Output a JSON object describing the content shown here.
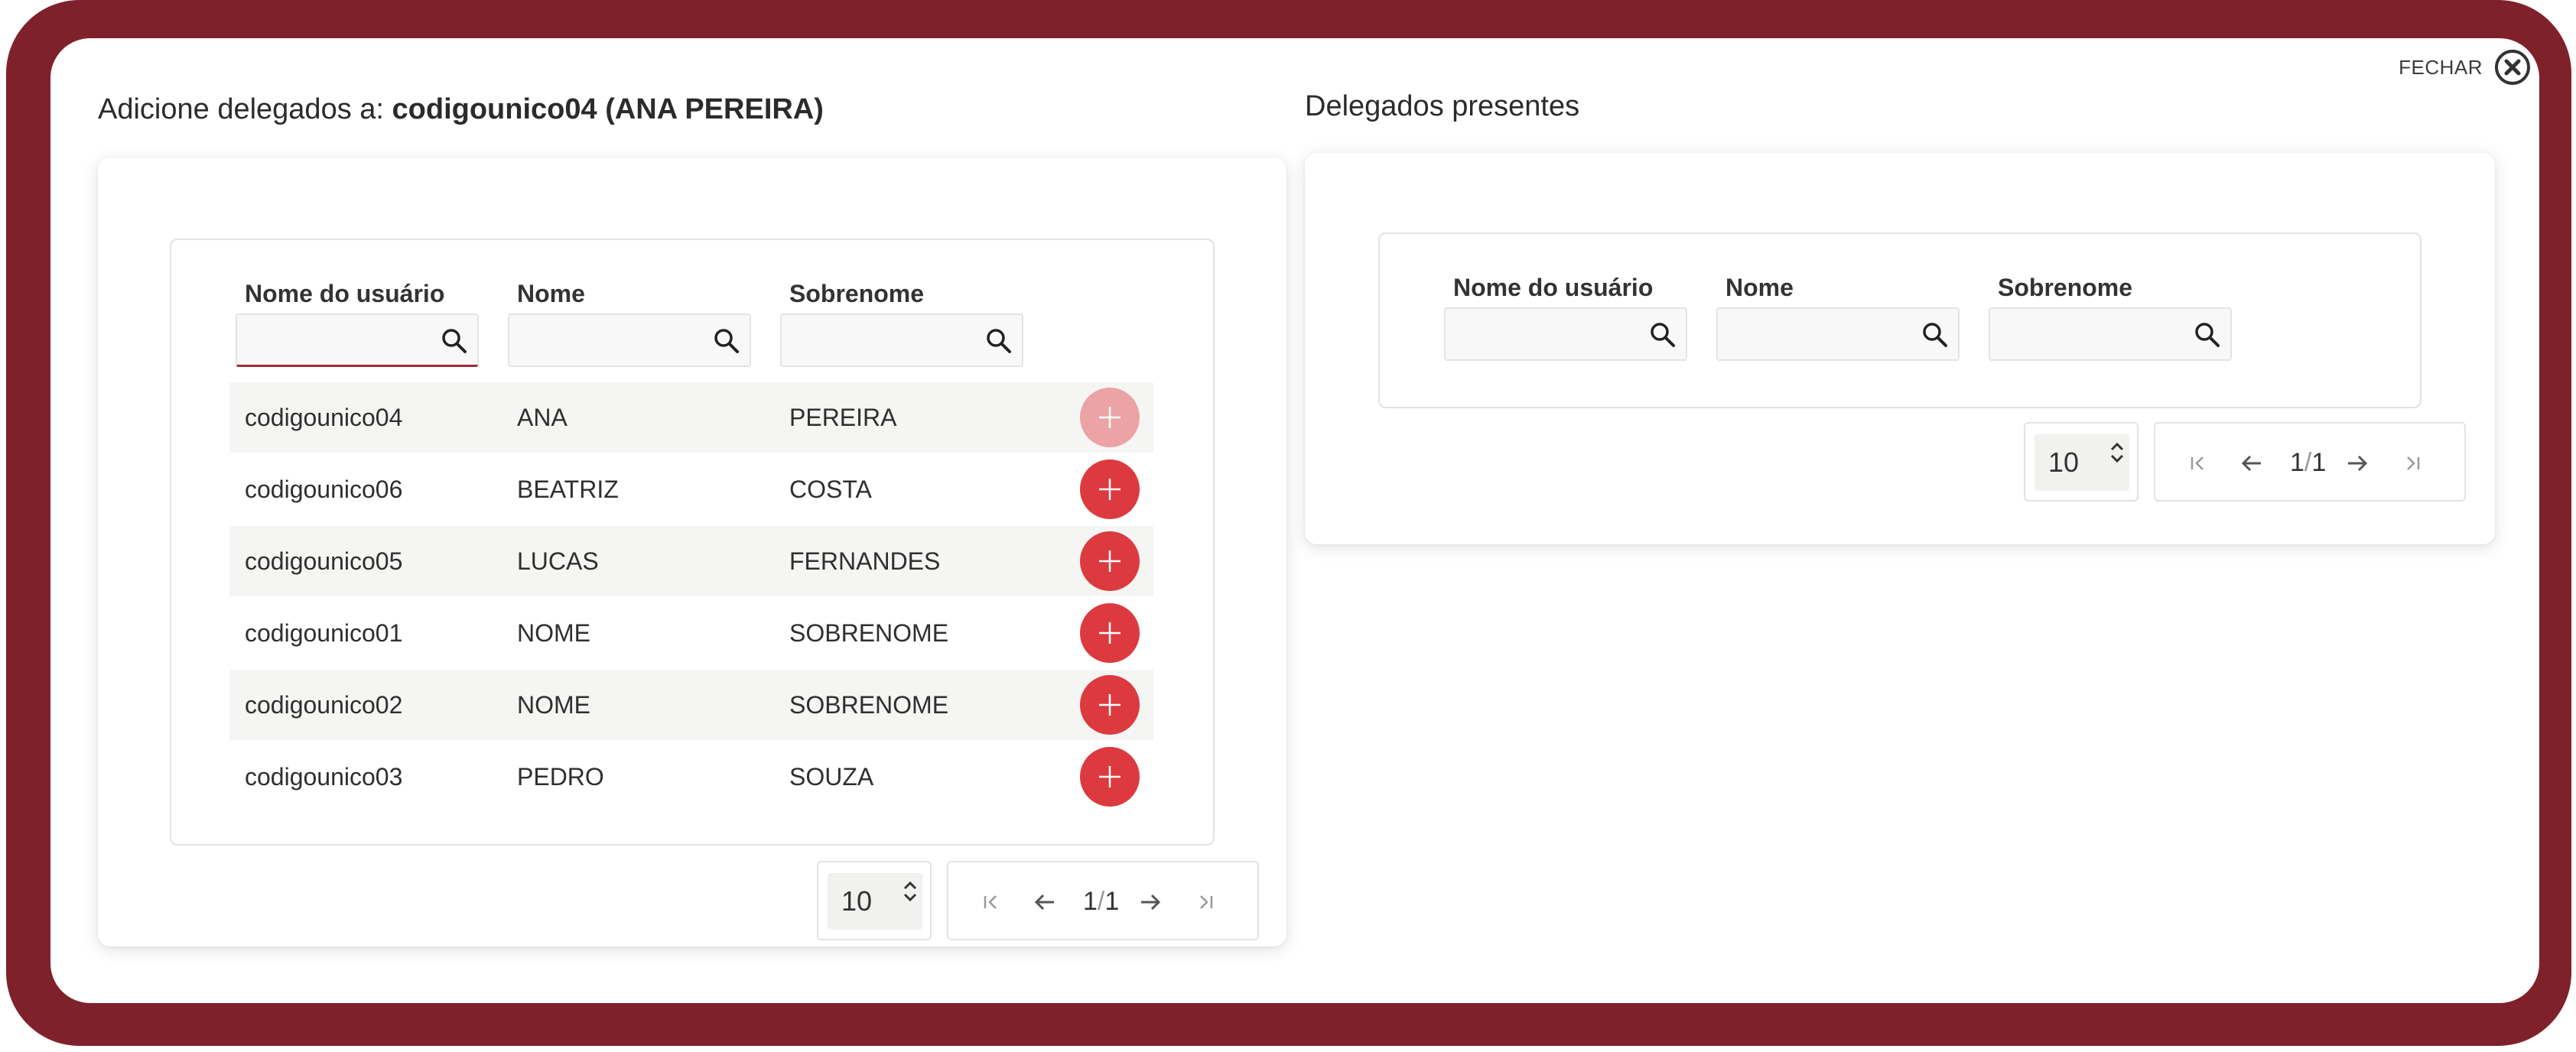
{
  "close": {
    "label": "FECHAR"
  },
  "left": {
    "heading_prefix": "Adicione delegados a: ",
    "heading_bold": "codigounico04 (ANA PEREIRA)",
    "columns": [
      "Nome do usuário",
      "Nome",
      "Sobrenome"
    ],
    "rows": [
      {
        "username": "codigounico04",
        "name": "ANA",
        "surname": "PEREIRA",
        "add_disabled": true
      },
      {
        "username": "codigounico06",
        "name": "BEATRIZ",
        "surname": "COSTA",
        "add_disabled": false
      },
      {
        "username": "codigounico05",
        "name": "LUCAS",
        "surname": "FERNANDES",
        "add_disabled": false
      },
      {
        "username": "codigounico01",
        "name": "NOME",
        "surname": "SOBRENOME",
        "add_disabled": false
      },
      {
        "username": "codigounico02",
        "name": "NOME",
        "surname": "SOBRENOME",
        "add_disabled": false
      },
      {
        "username": "codigounico03",
        "name": "PEDRO",
        "surname": "SOUZA",
        "add_disabled": false
      }
    ],
    "page_size": "10",
    "page_current": "1",
    "page_total": "1"
  },
  "right": {
    "heading": "Delegados presentes",
    "columns": [
      "Nome do usuário",
      "Nome",
      "Sobrenome"
    ],
    "page_size": "10",
    "page_current": "1",
    "page_total": "1"
  },
  "colors": {
    "frame": "#7f212b",
    "accent": "#dc3a3f",
    "accent_disabled": "#eba3a6",
    "row_alt": "#f5f5f3"
  }
}
